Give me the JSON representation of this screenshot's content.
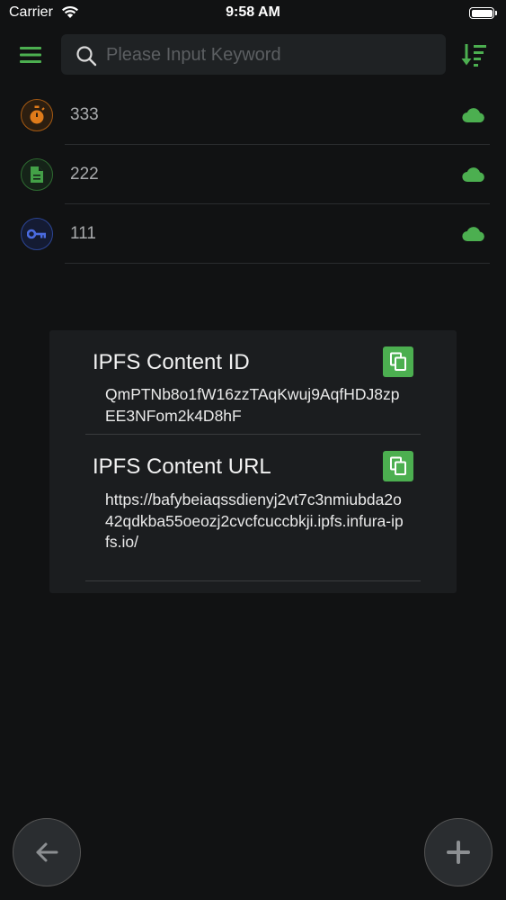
{
  "status_bar": {
    "carrier": "Carrier",
    "time": "9:58 AM"
  },
  "search": {
    "placeholder": "Please Input Keyword",
    "value": ""
  },
  "colors": {
    "accent": "#4caf50",
    "background": "#111213",
    "dialog": "#1b1d1f"
  },
  "items": [
    {
      "label": "333",
      "icon": "stopwatch-icon",
      "color": "#e07b1a",
      "status_icon": "cloud-icon"
    },
    {
      "label": "222",
      "icon": "document-icon",
      "color": "#43a047",
      "status_icon": "cloud-icon"
    },
    {
      "label": "111",
      "icon": "key-icon",
      "color": "#3a5bd0",
      "status_icon": "cloud-icon"
    }
  ],
  "dialog": {
    "cid_title": "IPFS Content ID",
    "cid_value": "QmPTNb8o1fW16zzTAqKwuj9AqfHDJ8zpEE3NFom2k4D8hF",
    "url_title": "IPFS Content URL",
    "url_value": "https://bafybeiaqssdienyj2vt7c3nmiubda2o42qdkba55oeozj2cvcfcuccbkji.ipfs.infura-ipfs.io/"
  },
  "fabs": {
    "back": "arrow-left-icon",
    "add": "plus-icon"
  }
}
